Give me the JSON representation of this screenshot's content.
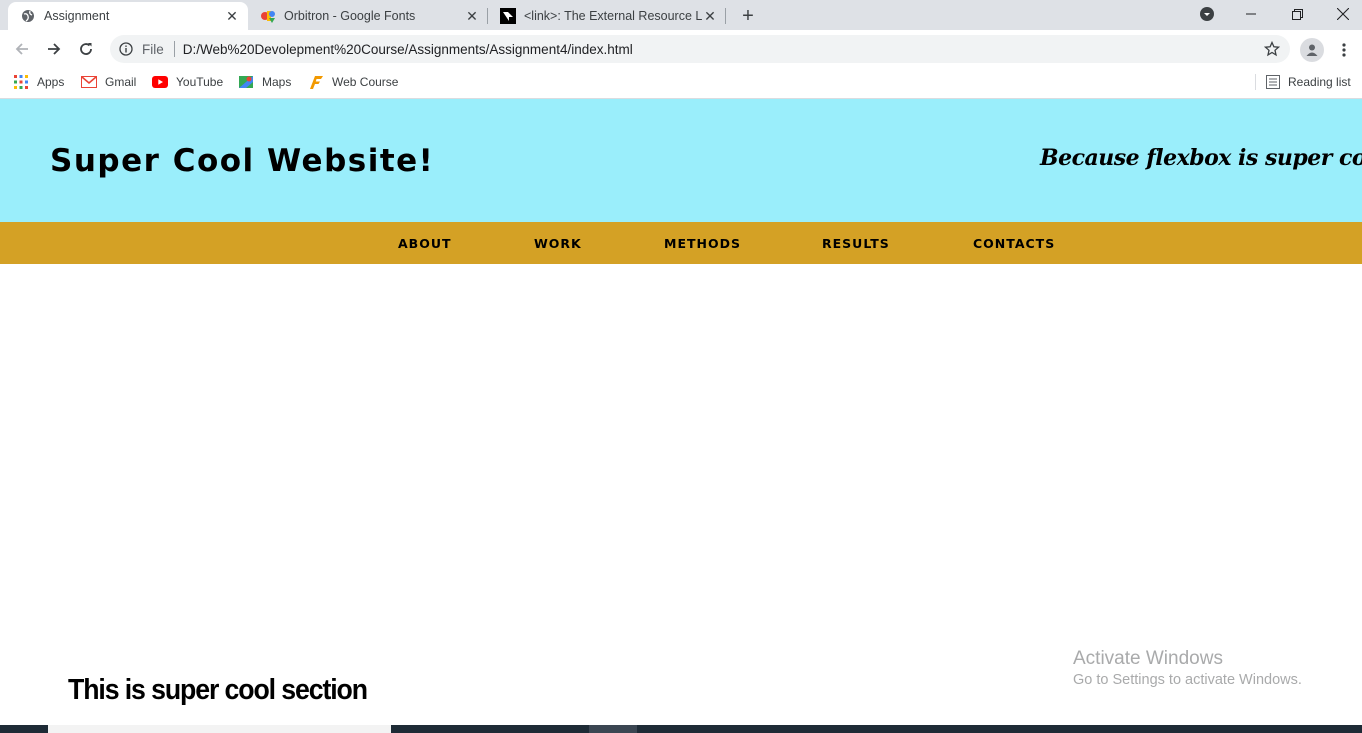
{
  "browser": {
    "tabs": [
      {
        "title": "Assignment",
        "active": true,
        "favicon": "globe-icon"
      },
      {
        "title": "Orbitron - Google Fonts",
        "active": false,
        "favicon": "google-fonts-icon"
      },
      {
        "title": "<link>: The External Resource Lin",
        "active": false,
        "favicon": "mdn-icon"
      }
    ],
    "address": {
      "scheme_label": "File",
      "url": "D:/Web%20Devolepment%20Course/Assignments/Assignment4/index.html"
    },
    "bookmarks": [
      {
        "label": "Apps",
        "icon": "apps-grid-icon"
      },
      {
        "label": "Gmail",
        "icon": "gmail-icon"
      },
      {
        "label": "YouTube",
        "icon": "youtube-icon"
      },
      {
        "label": "Maps",
        "icon": "maps-icon"
      },
      {
        "label": "Web Course",
        "icon": "web-course-icon"
      }
    ],
    "reading_list": "Reading list"
  },
  "page": {
    "header": {
      "title": "Super Cool Website!",
      "tagline": "Because flexbox is super cool!",
      "background": "#9aeefb"
    },
    "nav": {
      "background": "#d4a125",
      "links": [
        "ABOUT",
        "WORK",
        "METHODS",
        "RESULTS",
        "CONTACTS"
      ]
    },
    "section_heading": "This is super cool section"
  },
  "watermark": {
    "title": "Activate Windows",
    "subtitle": "Go to Settings to activate Windows."
  }
}
